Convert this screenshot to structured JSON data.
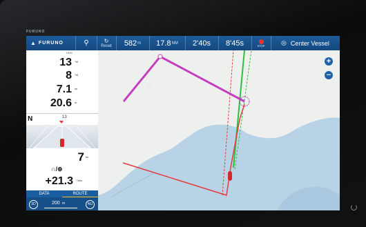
{
  "bezel": {
    "brand_top": "FURUNO"
  },
  "topbar": {
    "brand": "FURUNO",
    "reset_label": "Reset",
    "distance": "582",
    "distance_unit": "m",
    "range": "17.8",
    "range_unit": "NM",
    "time1": "2'40s",
    "time2": "8'45s",
    "stop_label": "STOP",
    "center_label": "Center Vessel"
  },
  "panel": {
    "hdg_label": "HDG",
    "hdg": "13",
    "hdg_unit": "°M",
    "cog": "8",
    "cog_unit": "°M",
    "sog": "7.1",
    "sog_unit": "kn",
    "dpt": "20.6",
    "dpt_unit": "m",
    "compass_n": "N",
    "compass_val": "13",
    "stw": "7",
    "stw_unit": "kn",
    "auto_label": "∩/⊕",
    "rot": "+21.3",
    "rot_unit": "°/min",
    "tab_data": "DATA",
    "tab_route": "ROUTE",
    "scale_left": "3D",
    "scale": "200",
    "scale_unit": "m",
    "scale_right": "NU"
  },
  "map": {
    "zoom_in": "+",
    "zoom_out": "−"
  },
  "colors": {
    "topbar": "#1a5797",
    "route": "#c23fbf",
    "track": "#e23b3b",
    "heading": "#2fbf3f",
    "land": "#eef0ee",
    "sea": "#b9d3e6"
  }
}
